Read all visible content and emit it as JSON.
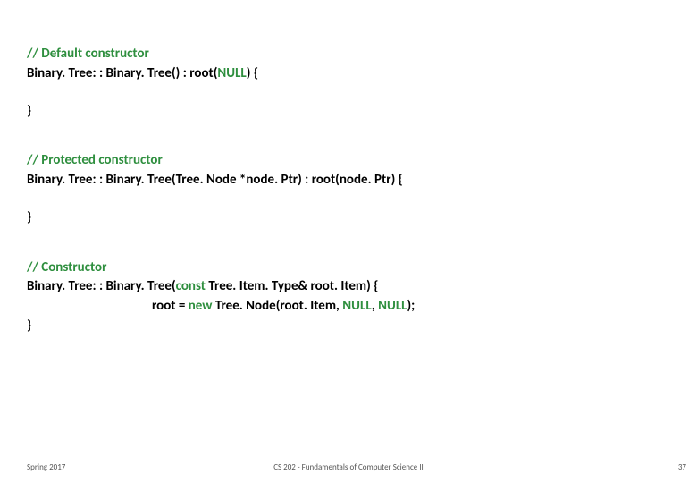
{
  "block1": {
    "comment": "// Default constructor",
    "line1_a": "Binary. Tree: : Binary. Tree() : root(",
    "line1_null": "NULL",
    "line1_b": ") {",
    "close": "}"
  },
  "block2": {
    "comment": "// Protected constructor",
    "line1": "Binary. Tree: : Binary. Tree(Tree. Node *node. Ptr) : root(node. Ptr) {",
    "close": "}"
  },
  "block3": {
    "comment": "// Constructor",
    "line1_a": "Binary. Tree: : Binary. Tree(",
    "line1_const": "const",
    "line1_b": " Tree. Item. Type& root. Item) {",
    "line2_a": "root = ",
    "line2_new": "new",
    "line2_b": " Tree. Node(root. Item, ",
    "line2_null1": "NULL",
    "line2_c": ", ",
    "line2_null2": "NULL",
    "line2_d": ");",
    "close": "}"
  },
  "footer": {
    "left": "Spring 2017",
    "center": "CS 202 - Fundamentals of Computer Science II",
    "right": "37"
  }
}
